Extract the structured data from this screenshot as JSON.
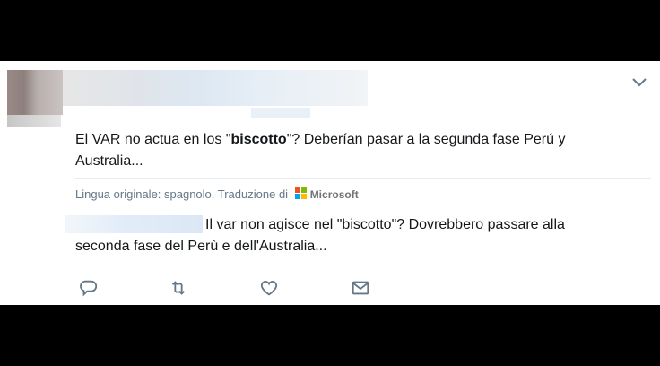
{
  "tweet": {
    "text_part1": "El VAR no actua en los \"",
    "text_bold": "biscotto",
    "text_part2": "\"? Deberían pasar a la segunda fase Perú y Australia...",
    "translation_label": "Lingua originale: spagnolo. Traduzione di",
    "translation_brand": "Microsoft",
    "translated_text": "Il var non agisce nel \"biscotto\"? Dovrebbero passare alla seconda fase del Perù e dell'Australia...",
    "ms_colors": [
      "#f25022",
      "#7fba00",
      "#00a4ef",
      "#ffb900"
    ]
  },
  "actions": {
    "reply_icon": "reply-icon",
    "retweet_icon": "retweet-icon",
    "like_icon": "heart-icon",
    "dm_icon": "envelope-icon"
  },
  "colors": {
    "text": "#14171a",
    "secondary": "#657786",
    "background": "#ffffff"
  }
}
